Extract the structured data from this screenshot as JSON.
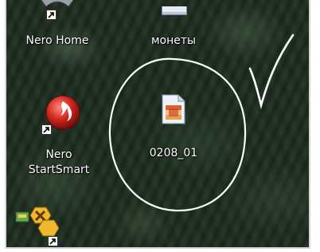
{
  "desktop": {
    "icons": [
      {
        "label": "Nero Home",
        "icon": "nero-home-icon",
        "shortcut": true
      },
      {
        "label": "монеты",
        "icon": "image-file-icon",
        "shortcut": false
      },
      {
        "label_lines": [
          "Nero",
          "StartSmart"
        ],
        "icon": "nero-startsmart-icon",
        "shortcut": true
      },
      {
        "label": "0208_01",
        "icon": "image-file-icon",
        "shortcut": false
      },
      {
        "label": "",
        "icon": "tools-icon",
        "shortcut": true
      }
    ]
  },
  "annotations": {
    "circle_color": "#ffffff",
    "checkmark_color": "#ffffff"
  },
  "colors": {
    "nero_red": "#d0281e",
    "desktop_bg": "#1c2a1f"
  }
}
